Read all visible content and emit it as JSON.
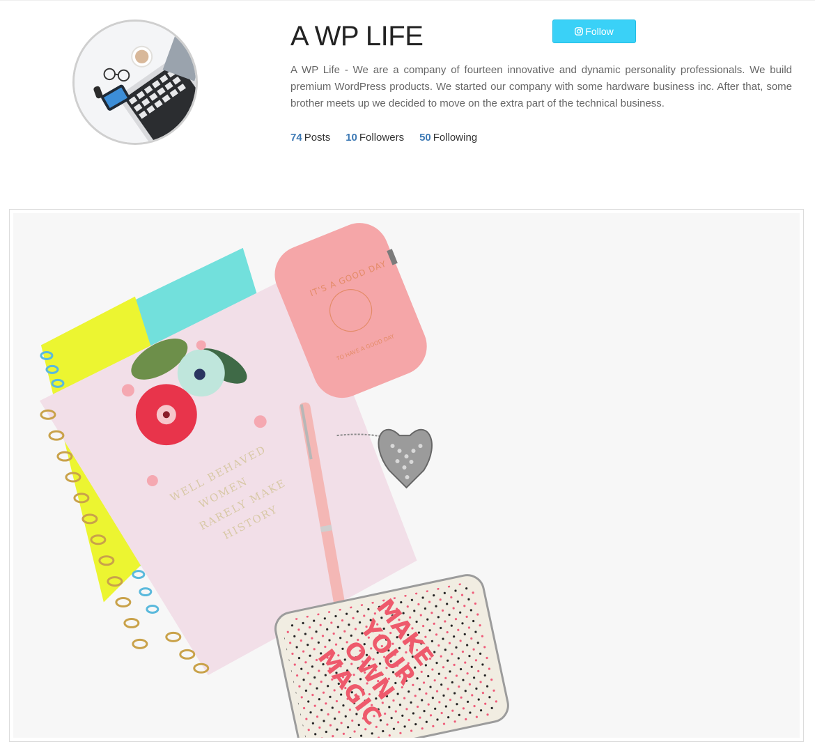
{
  "profile": {
    "name": "A WP LIFE",
    "bio": "A WP Life - We are a company of fourteen innovative and dynamic personality professionals. We build premium WordPress products. We started our company with some hardware business inc. After that, some brother meets up we decided to move on the extra part of the technical business.",
    "follow_label": "Follow",
    "follow_icon": "instagram-icon",
    "accent_color": "#3ad1f7",
    "stats_color": "#3e7ab5",
    "stats": [
      {
        "count": "74",
        "label": "Posts"
      },
      {
        "count": "10",
        "label": "Followers"
      },
      {
        "count": "50",
        "label": "Following"
      }
    ]
  },
  "post": {
    "image_text": {
      "notebook_line1": "WELL BEHAVED",
      "notebook_line2": "WOMEN",
      "notebook_line3": "RARELY MAKE",
      "notebook_line4": "HISTORY",
      "case_line1": "IT'S A GOOD DAY",
      "case_line2": "TO HAVE A GOOD DAY",
      "tin_line1": "MAKE",
      "tin_line2": "YOUR",
      "tin_line3": "OWN",
      "tin_line4": "MAGIC"
    }
  }
}
